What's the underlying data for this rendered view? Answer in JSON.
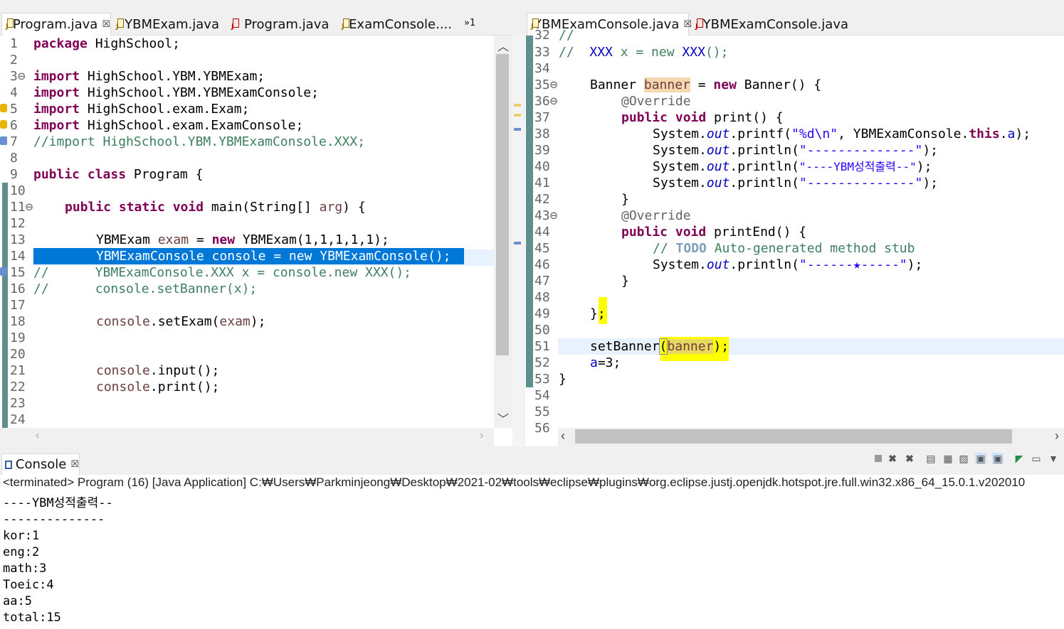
{
  "left_editor": {
    "tabs": [
      {
        "label": "Program.java",
        "active": true,
        "close": "☒"
      },
      {
        "label": "YBMExam.java",
        "active": false
      },
      {
        "label": "Program.java",
        "active": false
      },
      {
        "label": "ExamConsole....",
        "active": false
      }
    ],
    "overflow_label": "»1",
    "lines": [
      {
        "n": "1"
      },
      {
        "n": "2"
      },
      {
        "n": "3⊖"
      },
      {
        "n": "4"
      },
      {
        "n": "5"
      },
      {
        "n": "6"
      },
      {
        "n": "7"
      },
      {
        "n": "8"
      },
      {
        "n": "9"
      },
      {
        "n": "10"
      },
      {
        "n": "11⊖"
      },
      {
        "n": "12"
      },
      {
        "n": "13"
      },
      {
        "n": "14"
      },
      {
        "n": "15"
      },
      {
        "n": "16"
      },
      {
        "n": "17"
      },
      {
        "n": "18"
      },
      {
        "n": "19"
      },
      {
        "n": "20"
      },
      {
        "n": "21"
      },
      {
        "n": "22"
      },
      {
        "n": "23"
      },
      {
        "n": "24"
      }
    ],
    "code": {
      "l1a": "package",
      "l1b": " HighSchool;",
      "l3a": "import",
      "l3b": " HighSchool.YBM.YBMExam;",
      "l4a": "import",
      "l4b": " HighSchool.YBM.YBMExamConsole;",
      "l5a": "import",
      "l5b": " HighSchool.exam.Exam;",
      "l6a": "import",
      "l6b": " HighSchool.exam.ExamConsole;",
      "l7": "//import HighSchool.YBM.YBMExamConsole.XXX;",
      "l9a": "public class",
      "l9b": " Program {",
      "l11a": "public static void",
      "l11b": " main(String[] ",
      "l11c": "arg",
      "l11d": ") {",
      "l13a": "YBMExam ",
      "l13b": "exam",
      "l13c": " = ",
      "l13d": "new",
      "l13e": " YBMExam(1,1,1,1,1);",
      "l14": "YBMExamConsole console = new YBMExamConsole();",
      "l15": "//      YBMExamConsole.XXX x = console.new XXX();",
      "l16": "//      console.setBanner(x);",
      "l18a": "console",
      ".setExam(": "",
      "l18b": ".setExam(",
      "l18c": "exam",
      "l18d": ");",
      "l21a": "console",
      "l21b": ".input();",
      "l22a": "console",
      "l22b": ".print();"
    }
  },
  "right_editor": {
    "tabs": [
      {
        "label": "YBMExamConsole.java",
        "active": true,
        "close": "☒"
      },
      {
        "label": "YBMExamConsole.java",
        "active": false
      }
    ],
    "lines": [
      {
        "n": "32"
      },
      {
        "n": "33"
      },
      {
        "n": "34"
      },
      {
        "n": "35⊖"
      },
      {
        "n": "36⊖"
      },
      {
        "n": "37"
      },
      {
        "n": "38"
      },
      {
        "n": "39"
      },
      {
        "n": "40"
      },
      {
        "n": "41"
      },
      {
        "n": "42"
      },
      {
        "n": "43⊖"
      },
      {
        "n": "44"
      },
      {
        "n": "45"
      },
      {
        "n": "46"
      },
      {
        "n": "47"
      },
      {
        "n": "48"
      },
      {
        "n": "49"
      },
      {
        "n": "50"
      },
      {
        "n": "51"
      },
      {
        "n": "52"
      },
      {
        "n": "53"
      },
      {
        "n": "54"
      },
      {
        "n": "55"
      },
      {
        "n": "56"
      }
    ],
    "code": {
      "l32": "//",
      "l33a": "//  ",
      "l33b": "XXX",
      "l33c": " x = new ",
      "l33d": "XXX",
      "l33e": "();",
      "l35a": "Banner ",
      "l35b": "banner",
      "l35c": " = ",
      "l35d": "new",
      "l35e": " Banner() {",
      "l36": "@Override",
      "l37a": "public void",
      "l37b": " print() {",
      "l38a": "System.",
      "l38b": "out",
      "l38c": ".printf(",
      "l38d": "\"%d\\n\"",
      "l38e": ", YBMExamConsole.",
      "l38f": "this",
      "l38g": ".",
      "l38h": "a",
      "l38i": ");",
      "l39a": "System.",
      "l39b": "out",
      "l39c": ".println(",
      "l39d": "\"--------------\"",
      "l39e": ");",
      "l40a": "System.",
      "l40b": "out",
      "l40c": ".println(",
      "l40d": "\"----YBM성적출력--\"",
      "l40e": ");",
      "l41a": "System.",
      "l41b": "out",
      "l41c": ".println(",
      "l41d": "\"--------------\"",
      "l41e": ");",
      "l42": "}",
      "l43": "@Override",
      "l44a": "public void",
      "l44b": " printEnd() {",
      "l45a": "// ",
      "l45b": "TODO",
      "l45c": " Auto-generated method stub",
      "l46a": "System.",
      "l46b": "out",
      "l46c": ".println(",
      "l46d": "\"------★-----\"",
      "l46e": ");",
      "l47": "}",
      "l49": "};",
      "l51a": "setBanner",
      "l51b": "(",
      "l51c": "banner",
      "l51d": ");",
      "l52a": "a",
      "l52b": "=3;",
      "l53": "}"
    }
  },
  "console": {
    "tab_label": "Console",
    "close": "☒",
    "status": "<terminated> Program (16) [Java Application] C:₩Users₩Parkminjeong₩Desktop₩2021-02₩tools₩eclipse₩plugins₩org.eclipse.justj.openjdk.hotspot.jre.full.win32.x86_64_15.0.1.v202010",
    "output": [
      "----YBM성적출력--",
      "--------------",
      "kor:1",
      "eng:2",
      "math:3",
      "Toeic:4",
      "aa:5",
      "total:15"
    ]
  },
  "colors": {
    "keyword": "#7f0055",
    "comment": "#3f7f5f",
    "string": "#2a00ff",
    "selection": "#0078d7",
    "highlight": "#ffff00"
  }
}
